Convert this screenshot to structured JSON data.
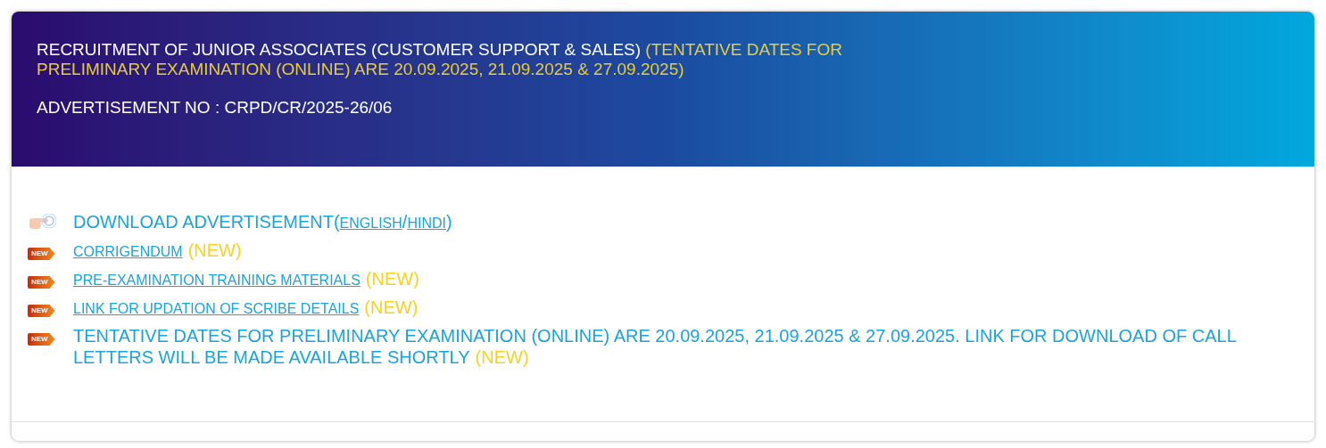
{
  "header": {
    "title": "RECRUITMENT OF JUNIOR ASSOCIATES (CUSTOMER SUPPORT & SALES)",
    "title_note": "(TENTATIVE DATES FOR PRELIMINARY EXAMINATION (ONLINE) ARE 20.09.2025, 21.09.2025 & 27.09.2025)",
    "advertisement": "ADVERTISEMENT NO : CRPD/CR/2025-26/06"
  },
  "items": [
    {
      "kind": "pointer",
      "segments": [
        {
          "kind": "text",
          "text": "DOWNLOAD ADVERTISEMENT("
        },
        {
          "kind": "link",
          "text": "ENGLISH"
        },
        {
          "kind": "text",
          "text": "/"
        },
        {
          "kind": "link",
          "text": "HINDI"
        },
        {
          "kind": "text",
          "text": ")"
        }
      ]
    },
    {
      "kind": "new",
      "badge": "NEW",
      "segments": [
        {
          "kind": "link",
          "text": "CORRIGENDUM"
        },
        {
          "kind": "new",
          "text": "(NEW)"
        }
      ]
    },
    {
      "kind": "new",
      "badge": "NEW",
      "segments": [
        {
          "kind": "link",
          "text": "PRE-EXAMINATION TRAINING MATERIALS"
        },
        {
          "kind": "new",
          "text": "(NEW)"
        }
      ]
    },
    {
      "kind": "new",
      "badge": "NEW",
      "segments": [
        {
          "kind": "link",
          "text": "LINK FOR UPDATION OF SCRIBE DETAILS"
        },
        {
          "kind": "new",
          "text": "(NEW)"
        }
      ]
    },
    {
      "kind": "new",
      "badge": "NEW",
      "segments": [
        {
          "kind": "text",
          "text": "TENTATIVE DATES FOR PRELIMINARY EXAMINATION (ONLINE) ARE 20.09.2025, 21.09.2025 & 27.09.2025. LINK FOR DOWNLOAD OF CALL LETTERS WILL BE MADE AVAILABLE SHORTLY"
        },
        {
          "kind": "new",
          "text": "(NEW)"
        }
      ]
    }
  ]
}
